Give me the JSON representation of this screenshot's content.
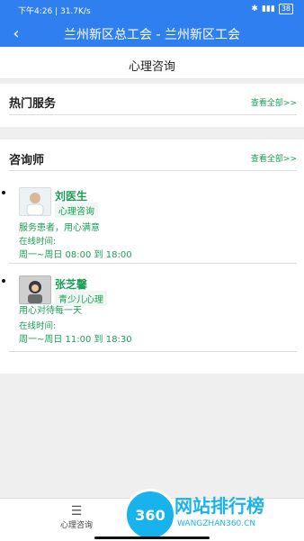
{
  "status_bar": {
    "time": "下午4:26 | 31.7K/s",
    "battery": "38"
  },
  "title_bar": {
    "title": "兰州新区总工会 - 兰州新区工会"
  },
  "page_header": {
    "title": "心理咨询"
  },
  "hot_services": {
    "title": "热门服务",
    "more": "查看全部>>"
  },
  "consultants": {
    "title": "咨询师",
    "more": "查看全部>>",
    "items": [
      {
        "name": "刘医生",
        "tag": "心理咨询",
        "desc": "服务患者，用心满意",
        "online_label": "在线时间:",
        "hours": "周一~周日 08:00 到 18:00"
      },
      {
        "name": "张芝馨",
        "tag": "青少儿心理",
        "desc": "用心对待每一天",
        "online_label": "在线时间:",
        "hours": "周一~周日 11:00 到 18:30"
      }
    ]
  },
  "bottom_nav": {
    "tab_label": "心理咨询"
  },
  "watermark": {
    "badge": "360",
    "title": "网站排行榜",
    "sub": "WANGZHAN360.CN"
  },
  "colors": {
    "primary": "#2f7ff0",
    "accent_green": "#1a9e55"
  }
}
